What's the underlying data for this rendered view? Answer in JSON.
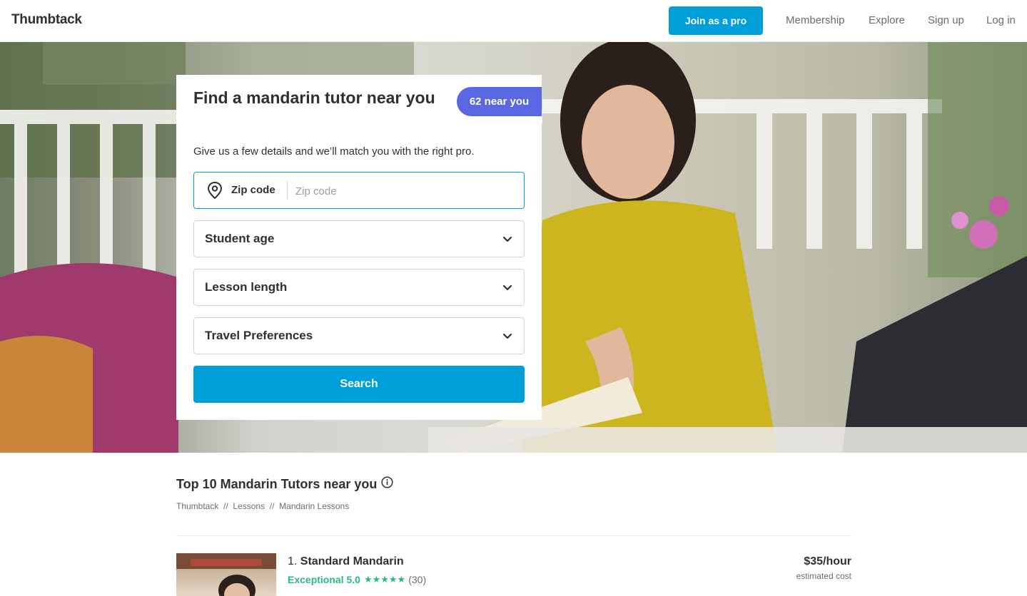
{
  "header": {
    "logo": "Thumbtack",
    "join_button": "Join as a pro",
    "nav": [
      "Membership",
      "Explore",
      "Sign up",
      "Log in"
    ]
  },
  "hero": {
    "image_alt": "Tutor reading a book with a student at a table"
  },
  "form": {
    "title": "Find a mandarin tutor near you",
    "badge": "62 near you",
    "subtitle": "Give us a few details and we’ll match you with the right pro.",
    "zip_label": "Zip code",
    "zip_placeholder": "Zip code",
    "zip_value": "",
    "selects": [
      "Student age",
      "Lesson length",
      "Travel Preferences"
    ],
    "search_button": "Search"
  },
  "results": {
    "title": "Top 10 Mandarin Tutors near you",
    "breadcrumb": [
      "Thumbtack",
      "Lessons",
      "Mandarin Lessons"
    ],
    "breadcrumb_separator": "//",
    "pros": [
      {
        "rank": "1.",
        "name": "Standard Mandarin",
        "rating_label": "Exceptional 5.0",
        "stars": 5,
        "reviews": "(30)",
        "price": "$35/hour",
        "price_note": "estimated cost"
      }
    ]
  },
  "colors": {
    "brand_blue": "#009fd9",
    "badge_purple": "#5968e2",
    "rating_green": "#2db783",
    "text": "#2f3033",
    "muted": "#676d73"
  }
}
